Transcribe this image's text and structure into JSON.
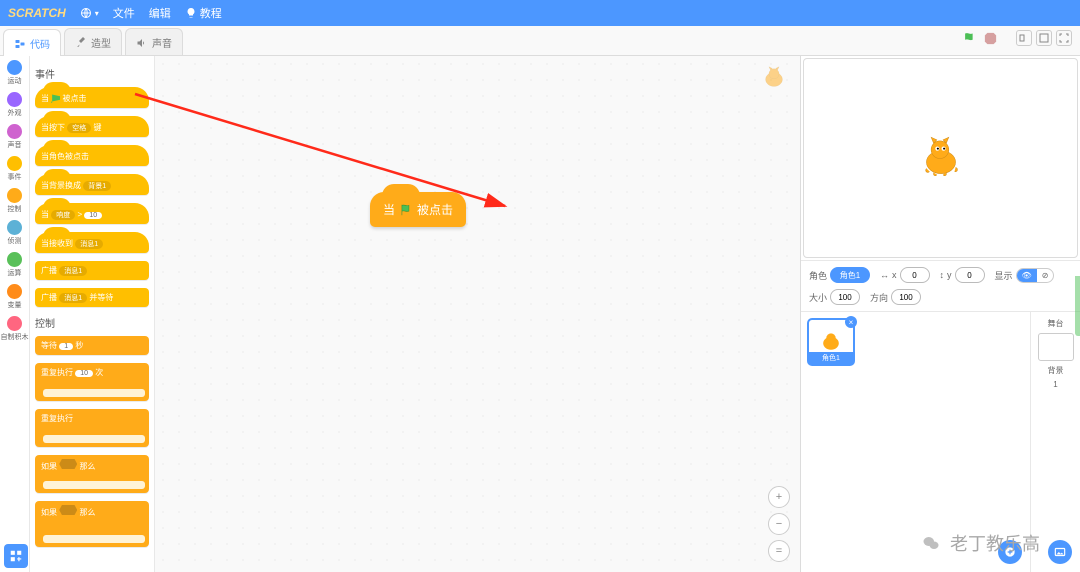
{
  "menubar": {
    "logo": "SCRATCH",
    "file": "文件",
    "edit": "编辑",
    "tutorials": "教程"
  },
  "tabs": {
    "code": "代码",
    "costumes": "造型",
    "sounds": "声音"
  },
  "categories": [
    {
      "label": "运动",
      "color": "#4c97ff"
    },
    {
      "label": "外观",
      "color": "#9966ff"
    },
    {
      "label": "声音",
      "color": "#cf63cf"
    },
    {
      "label": "事件",
      "color": "#ffbf00"
    },
    {
      "label": "控制",
      "color": "#ffab19"
    },
    {
      "label": "侦测",
      "color": "#5cb1d6"
    },
    {
      "label": "运算",
      "color": "#59c059"
    },
    {
      "label": "变量",
      "color": "#ff8c1a"
    },
    {
      "label": "自制积木",
      "color": "#ff6680"
    }
  ],
  "palette": {
    "events_title": "事件",
    "control_title": "控制",
    "when_flag": "被点击",
    "when_key_pre": "当按下",
    "when_key_dd": "空格",
    "when_key_post": "键",
    "when_sprite": "当角色被点击",
    "when_backdrop_pre": "当背景换成",
    "when_backdrop_dd": "背景1",
    "when_greater_pre": "当",
    "when_greater_dd": "响度",
    "when_greater_gt": ">",
    "when_greater_val": "10",
    "when_receive_pre": "当接收到",
    "when_receive_dd": "消息1",
    "broadcast_pre": "广播",
    "broadcast_dd": "消息1",
    "broadcast_wait_pre": "广播",
    "broadcast_wait_dd": "消息1",
    "broadcast_wait_post": "并等待",
    "wait_pre": "等待",
    "wait_val": "1",
    "wait_post": "秒",
    "repeat_pre": "重复执行",
    "repeat_val": "10",
    "repeat_post": "次",
    "forever": "重复执行",
    "if_pre": "如果",
    "if_post": "那么"
  },
  "script": {
    "dropped_pre": "当",
    "dropped_post": "被点击"
  },
  "sprite": {
    "label_name": "角色",
    "name": "角色1",
    "x_label": "x",
    "x": "0",
    "y_label": "y",
    "y": "0",
    "show_label": "显示",
    "size_label": "大小",
    "size": "100",
    "direction_label": "方向",
    "direction": "100"
  },
  "stage_panel": {
    "title": "舞台",
    "backdrop_label": "背景",
    "backdrop_count": "1"
  },
  "watermark": "老丁教乐高"
}
